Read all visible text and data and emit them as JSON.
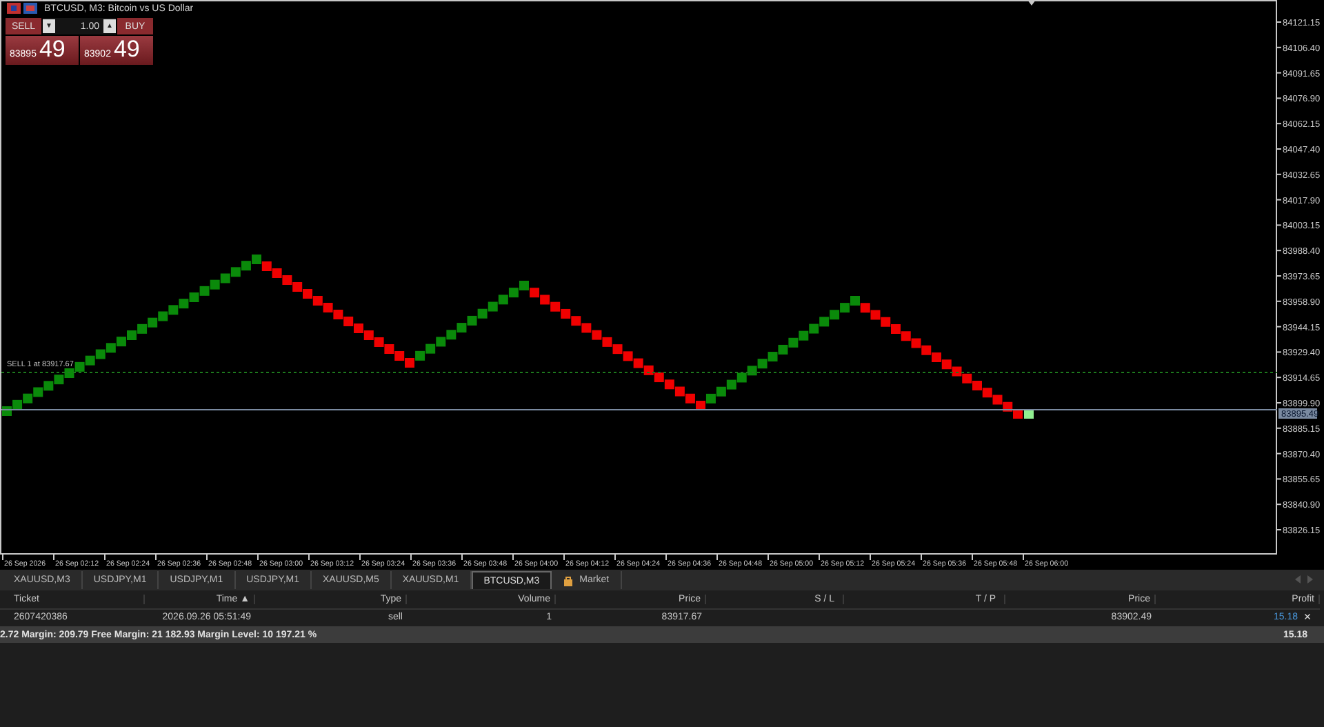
{
  "chart": {
    "title": "BTCUSD, M3: Bitcoin vs US Dollar",
    "trade_panel": {
      "sell_label": "SELL",
      "buy_label": "BUY",
      "volume": "1.00",
      "down": "▼",
      "up": "▲",
      "sell_price": "83895",
      "sell_big": "49",
      "buy_price": "83902",
      "buy_big": "49"
    },
    "price_labels": [
      "84121.15",
      "84106.40",
      "84091.65",
      "84076.90",
      "84062.15",
      "84047.40",
      "84032.65",
      "84017.90",
      "84003.15",
      "83988.40",
      "83973.65",
      "83958.90",
      "83944.15",
      "83929.40",
      "83914.65",
      "83899.90",
      "83885.15",
      "83870.40",
      "83855.65",
      "83840.90",
      "83826.15"
    ],
    "bid_label": "83895.49",
    "trade_line_label": "SELL 1 at 83917.67",
    "time_labels": [
      "26 Sep 2026",
      "26 Sep 02:12",
      "26 Sep 02:24",
      "26 Sep 02:36",
      "26 Sep 02:48",
      "26 Sep 03:00",
      "26 Sep 03:12",
      "26 Sep 03:24",
      "26 Sep 03:36",
      "26 Sep 03:48",
      "26 Sep 04:00",
      "26 Sep 04:12",
      "26 Sep 04:24",
      "26 Sep 04:36",
      "26 Sep 04:48",
      "26 Sep 05:00",
      "26 Sep 05:12",
      "26 Sep 05:24",
      "26 Sep 05:36",
      "26 Sep 05:48",
      "26 Sep 06:00"
    ]
  },
  "tabs": [
    {
      "label": "XAUUSD,M3",
      "selected": false
    },
    {
      "label": "USDJPY,M1",
      "selected": false
    },
    {
      "label": "USDJPY,M1",
      "selected": false
    },
    {
      "label": "USDJPY,M1",
      "selected": false
    },
    {
      "label": "XAUUSD,M5",
      "selected": false
    },
    {
      "label": "XAUUSD,M1",
      "selected": false
    },
    {
      "label": "BTCUSD,M3",
      "selected": true
    },
    {
      "label": "Market",
      "selected": false,
      "kind": "market"
    }
  ],
  "table": {
    "columns": [
      "Ticket",
      "Time ▲",
      "Type",
      "Volume",
      "Price",
      "S / L",
      "T / P",
      "Price",
      "Profit"
    ],
    "rows": [
      {
        "cells": [
          "2607420386",
          "2026.09.26 05:51:49",
          "sell",
          "1",
          "83917.67",
          "",
          "",
          "83902.49",
          "15.18"
        ],
        "close": "×"
      }
    ]
  },
  "summary": {
    "text": "2.72  Margin: 209.79  Free Margin: 21 182.93  Margin Level: 10 197.21 %",
    "total": "15.18"
  }
}
